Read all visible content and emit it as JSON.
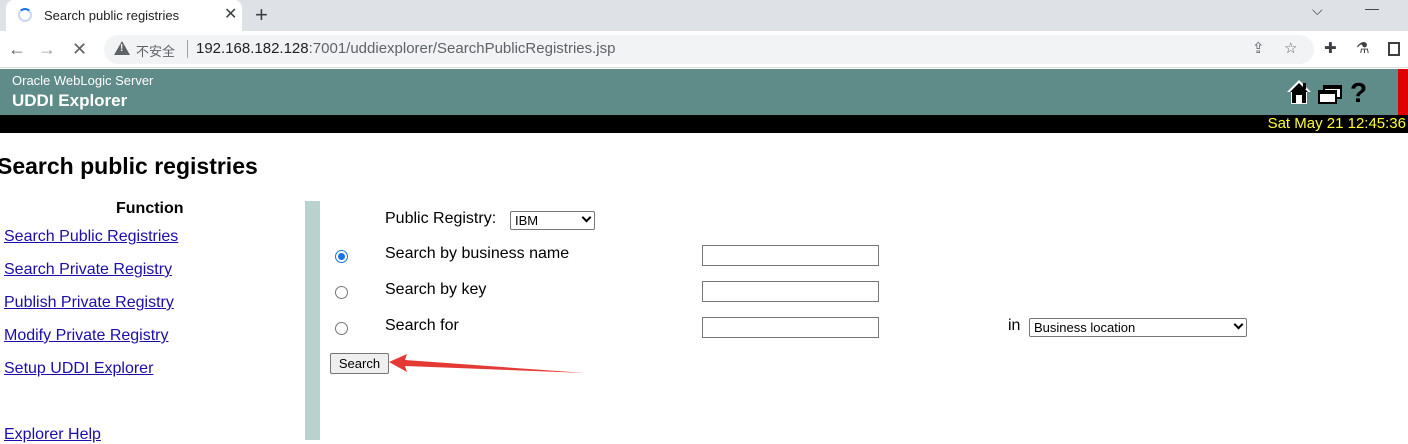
{
  "browser": {
    "tab_title": "Search public registries",
    "tab_close": "✕",
    "new_tab": "+",
    "security_label": "不安全",
    "url_host": "192.168.182.128",
    "url_rest": ":7001/uddiexplorer/SearchPublicRegistries.jsp",
    "icons": [
      "back-icon",
      "forward-icon",
      "stop-icon",
      "warning-icon",
      "share-icon",
      "star-icon",
      "extensions-icon",
      "flask-icon",
      "sidepanel-icon"
    ]
  },
  "header": {
    "product": "Oracle WebLogic Server",
    "app": "UDDI Explorer",
    "datetime": "Sat May 21 12:45:36",
    "icons": [
      "home-icon",
      "windows-icon",
      "help-icon"
    ],
    "accent": "#5f8b88",
    "date_color": "#ffff33"
  },
  "page": {
    "title": "Search public registries"
  },
  "sidebar": {
    "heading": "Function",
    "links": [
      "Search Public Registries",
      "Search Private Registry",
      "Publish Private Registry",
      "Modify Private Registry",
      "Setup UDDI Explorer",
      "Explorer Help"
    ]
  },
  "form": {
    "registry_label": "Public Registry:",
    "registry_value": "IBM",
    "options": [
      {
        "label": "Search by business name",
        "checked": true,
        "value": ""
      },
      {
        "label": "Search by key",
        "checked": false,
        "value": ""
      },
      {
        "label": "Search for",
        "checked": false,
        "value": ""
      }
    ],
    "in_label": "in",
    "search_for_field": "Business location",
    "search_button": "Search"
  },
  "annotation_color": "#e53935"
}
